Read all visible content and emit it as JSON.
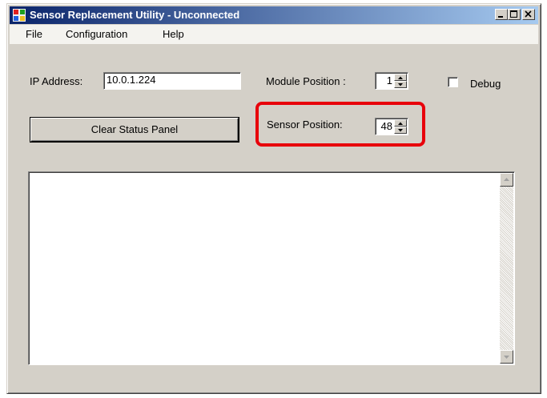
{
  "window": {
    "title": "Sensor Replacement Utility - Unconnected",
    "icon": "app-window-icon",
    "controls": [
      "minimize-icon",
      "maximize-icon",
      "close-icon"
    ]
  },
  "menu": {
    "items": [
      {
        "label": "File"
      },
      {
        "label": "Configuration"
      },
      {
        "label": "Help"
      }
    ]
  },
  "form": {
    "ip_label": "IP Address:",
    "ip_value": "10.0.1.224",
    "module_label": "Module Position :",
    "module_value": "1",
    "debug_label": "Debug",
    "debug_checked": false,
    "clear_button_label": "Clear Status Panel",
    "sensor_label": "Sensor Position:",
    "sensor_value": "48"
  },
  "colors": {
    "highlight": "#e8000b",
    "titlebar_start": "#0a246a",
    "titlebar_end": "#a6caf0",
    "window_bg": "#d4d0c8"
  }
}
